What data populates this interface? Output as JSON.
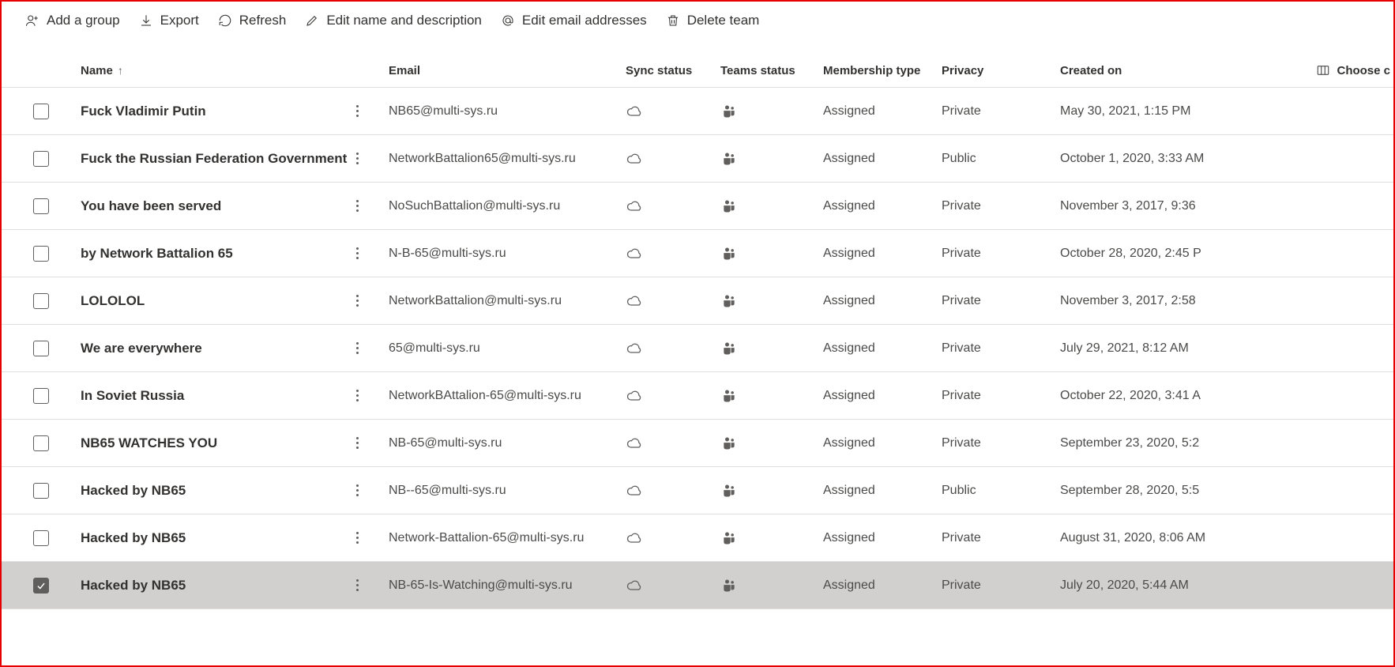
{
  "toolbar": {
    "add_group": "Add a group",
    "export": "Export",
    "refresh": "Refresh",
    "edit_name_desc": "Edit name and description",
    "edit_email": "Edit email addresses",
    "delete_team": "Delete team"
  },
  "columns": {
    "name": "Name",
    "email": "Email",
    "sync_status": "Sync status",
    "teams_status": "Teams status",
    "membership_type": "Membership type",
    "privacy": "Privacy",
    "created_on": "Created on",
    "choose_columns": "Choose c"
  },
  "rows": [
    {
      "checked": false,
      "name": "Fuck Vladimir Putin",
      "email": "NB65@multi-sys.ru",
      "membership": "Assigned",
      "privacy": "Private",
      "created": "May 30, 2021, 1:15 PM"
    },
    {
      "checked": false,
      "name": "Fuck the Russian Federation Government",
      "email": "NetworkBattalion65@multi-sys.ru",
      "membership": "Assigned",
      "privacy": "Public",
      "created": "October 1, 2020, 3:33 AM"
    },
    {
      "checked": false,
      "name": "You have been served",
      "email": "NoSuchBattalion@multi-sys.ru",
      "membership": "Assigned",
      "privacy": "Private",
      "created": "November 3, 2017, 9:36"
    },
    {
      "checked": false,
      "name": "by Network Battalion 65",
      "email": "N-B-65@multi-sys.ru",
      "membership": "Assigned",
      "privacy": "Private",
      "created": "October 28, 2020, 2:45 P"
    },
    {
      "checked": false,
      "name": "LOLOLOL",
      "email": "NetworkBattalion@multi-sys.ru",
      "membership": "Assigned",
      "privacy": "Private",
      "created": "November 3, 2017, 2:58"
    },
    {
      "checked": false,
      "name": "We are everywhere",
      "email": "65@multi-sys.ru",
      "membership": "Assigned",
      "privacy": "Private",
      "created": "July 29, 2021, 8:12 AM"
    },
    {
      "checked": false,
      "name": "In Soviet Russia",
      "email": "NetworkBAttalion-65@multi-sys.ru",
      "membership": "Assigned",
      "privacy": "Private",
      "created": "October 22, 2020, 3:41 A"
    },
    {
      "checked": false,
      "name": "NB65 WATCHES YOU",
      "email": "NB-65@multi-sys.ru",
      "membership": "Assigned",
      "privacy": "Private",
      "created": "September 23, 2020, 5:2"
    },
    {
      "checked": false,
      "name": "Hacked by NB65",
      "email": "NB--65@multi-sys.ru",
      "membership": "Assigned",
      "privacy": "Public",
      "created": "September 28, 2020, 5:5"
    },
    {
      "checked": false,
      "name": "Hacked by NB65",
      "email": "Network-Battalion-65@multi-sys.ru",
      "membership": "Assigned",
      "privacy": "Private",
      "created": "August 31, 2020, 8:06 AM"
    },
    {
      "checked": true,
      "name": "Hacked by NB65",
      "email": "NB-65-Is-Watching@multi-sys.ru",
      "membership": "Assigned",
      "privacy": "Private",
      "created": "July 20, 2020, 5:44 AM"
    }
  ]
}
